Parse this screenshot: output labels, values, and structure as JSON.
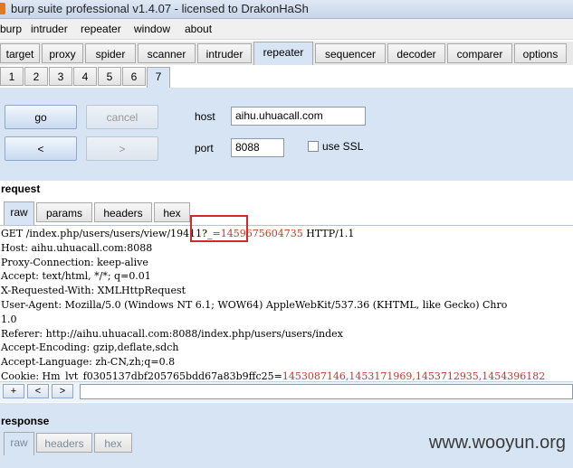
{
  "window": {
    "title": "burp suite professional v1.4.07 - licensed to DrakonHaSh"
  },
  "menu": [
    "burp",
    "intruder",
    "repeater",
    "window",
    "about"
  ],
  "main_tabs": [
    "target",
    "proxy",
    "spider",
    "scanner",
    "intruder",
    "repeater",
    "sequencer",
    "decoder",
    "comparer",
    "options"
  ],
  "repeater_tabs": [
    "1",
    "2",
    "3",
    "4",
    "5",
    "6",
    "7"
  ],
  "controls": {
    "go": "go",
    "cancel": "cancel",
    "back": "<",
    "forward": ">",
    "host_label": "host",
    "host_value": "aihu.uhuacall.com",
    "port_label": "port",
    "port_value": "8088",
    "ssl_label": "use SSL"
  },
  "request": {
    "section": "request",
    "tabs": [
      "raw",
      "params",
      "headers",
      "hex"
    ],
    "line1": {
      "a": "GET /index.php/users/users/view/19411?_",
      "b": "=1459675604735",
      "c": " HTTP/1.1"
    },
    "lines": [
      "Host: aihu.uhuacall.com:8088",
      "Proxy-Connection: keep-alive",
      "Accept: text/html, */*; q=0.01",
      "X-Requested-With: XMLHttpRequest",
      "User-Agent: Mozilla/5.0 (Windows NT 6.1; WOW64) AppleWebKit/537.36 (KHTML, like Gecko) Chro",
      "1.0",
      "Referer: http://aihu.uhuacall.com:8088/index.php/users/users/index",
      "Accept-Encoding: gzip,deflate,sdch",
      "Accept-Language: zh-CN,zh;q=0.8"
    ],
    "cookie": {
      "a": "Cookie: Hm_lvt_f0305137dbf205765bdd67a83b9ffc25=",
      "b": "1453087146,1453171969,1453712935,1454396182"
    },
    "nav": [
      "+",
      "<",
      ">"
    ]
  },
  "response": {
    "section": "response",
    "tabs": [
      "raw",
      "headers",
      "hex"
    ]
  },
  "watermark": "www.wooyun.org"
}
